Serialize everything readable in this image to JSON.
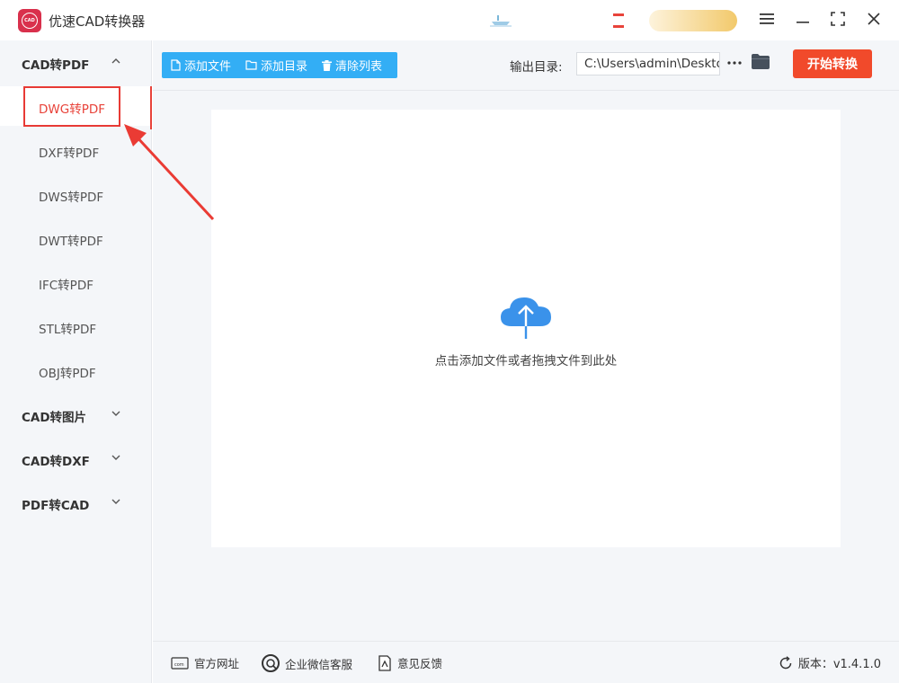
{
  "app": {
    "title": "优速CAD转换器",
    "logo_text": "CAD",
    "brand_color": "#d9304c",
    "accent_red": "#e8433a",
    "accent_blue": "#33aef5",
    "start_color": "#f14a2b"
  },
  "window_controls": [
    "menu-icon",
    "minimize-icon",
    "maximize-icon",
    "close-icon"
  ],
  "sidebar": {
    "groups": [
      {
        "label": "CAD转PDF",
        "expanded": true,
        "items": [
          "DWG转PDF",
          "DXF转PDF",
          "DWS转PDF",
          "DWT转PDF",
          "IFC转PDF",
          "STL转PDF",
          "OBJ转PDF"
        ],
        "active_item": "DWG转PDF"
      },
      {
        "label": "CAD转图片",
        "expanded": false
      },
      {
        "label": "CAD转DXF",
        "expanded": false
      },
      {
        "label": "PDF转CAD",
        "expanded": false
      }
    ]
  },
  "toolbar": {
    "add_file": "添加文件",
    "add_folder": "添加目录",
    "clear_list": "清除列表",
    "output_label": "输出目录:",
    "output_path": "C:\\Users\\admin\\Deskto",
    "more": "···",
    "start": "开始转换"
  },
  "drop_area": {
    "text": "点击添加文件或者拖拽文件到此处",
    "icon": "upload-cloud-icon"
  },
  "footer": {
    "website": "官方网址",
    "wechat": "企业微信客服",
    "feedback": "意见反馈",
    "version": "版本：v1.4.1.0"
  }
}
